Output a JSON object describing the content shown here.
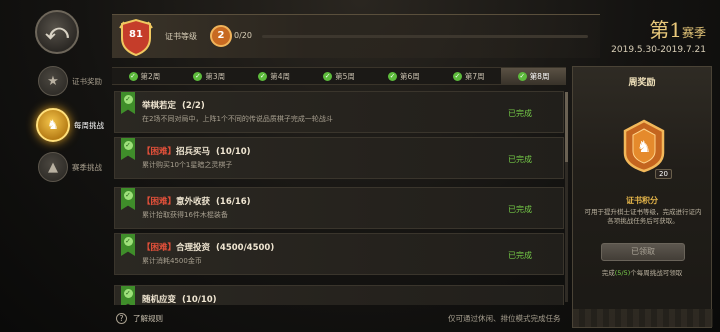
{
  "rail": {
    "back_icon": "back-arrow-icon",
    "items": [
      {
        "label": "证书奖励",
        "icon": "medal-icon",
        "active": false
      },
      {
        "label": "每周挑战",
        "icon": "chess-knight-icon",
        "active": true
      },
      {
        "label": "赛季挑战",
        "icon": "mountain-icon",
        "active": false
      }
    ]
  },
  "header": {
    "level": "81",
    "level_label": "证书等级",
    "next_level": "2",
    "progress_text": "0/20",
    "progress_fraction": 0.0,
    "season_prefix": "第",
    "season_number": "1",
    "season_suffix": "赛季",
    "season_range": "2019.5.30-2019.7.21"
  },
  "weeks": [
    {
      "label": "第2周",
      "done": true,
      "active": false
    },
    {
      "label": "第3周",
      "done": true,
      "active": false
    },
    {
      "label": "第4周",
      "done": true,
      "active": false
    },
    {
      "label": "第5周",
      "done": true,
      "active": false
    },
    {
      "label": "第6周",
      "done": true,
      "active": false
    },
    {
      "label": "第7周",
      "done": true,
      "active": false
    },
    {
      "label": "第8周",
      "done": true,
      "active": true
    }
  ],
  "tasks": [
    {
      "hard": "",
      "title": "举棋若定",
      "count": "(2/2)",
      "desc": "在2场不同对局中，上阵1个不同的传说品质棋子完成一轮战斗",
      "status": "已完成"
    },
    {
      "hard": "【困难】",
      "title": "招兵买马",
      "count": "(10/10)",
      "desc": "累计购买10个1星暗之灵棋子",
      "status": "已完成"
    },
    {
      "hard": "【困难】",
      "title": "意外收获",
      "count": "(16/16)",
      "desc": "累计拾取获得16件木棍装备",
      "status": "已完成"
    },
    {
      "hard": "【困难】",
      "title": "合理投资",
      "count": "(4500/4500)",
      "desc": "累计消耗4500金币",
      "status": "已完成"
    },
    {
      "hard": "",
      "title": "随机应变",
      "count": "(10/10)",
      "desc": "",
      "status": ""
    }
  ],
  "footer": {
    "help": "了解规则",
    "help_icon": "question-icon",
    "note": "仅可通过休闲、排位模式完成任务"
  },
  "weekly": {
    "title": "周奖励",
    "reward_icon": "certificate-badge-icon",
    "reward_count": "20",
    "reward_name": "证书积分",
    "reward_desc": "可用于提升棋士证书等级，完成进行证内各项挑战任务后可获取。",
    "claim_label": "已领取",
    "claim_note_prefix": "完成",
    "claim_note_count": "(5/5)",
    "claim_note_suffix": "个每周挑战可领取"
  },
  "colors": {
    "accent": "#e7b74a",
    "done": "#74c947",
    "hard": "#e2503a"
  }
}
